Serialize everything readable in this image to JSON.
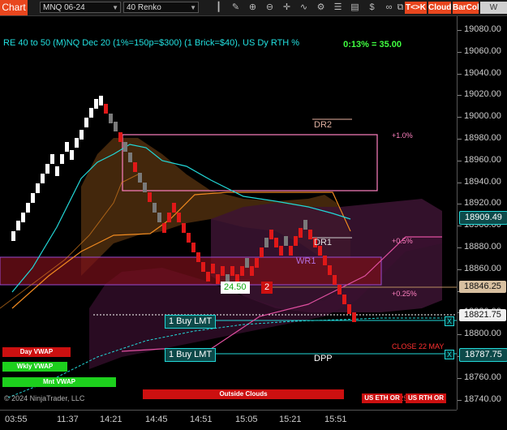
{
  "toolbar": {
    "chart_label": "Chart",
    "instrument": "MNQ 06-24",
    "bar_type": "40 Renko",
    "btn_tk": "T<>K",
    "btn_cloud": "Cloud",
    "btn_barcol": "BarCol",
    "btn_vwap": "W VWAP",
    "colors": {
      "chart": "#e8461e",
      "tk": "#e8461e",
      "cloud": "#e8461e",
      "barcol": "#e8461e",
      "vwap": "#cfcfcf"
    }
  },
  "header": {
    "title": "RE 40 to 50 (M)NQ Dec 20 (1%=150p=$300) (1 Brick=$40), US Dy RTH %",
    "status": "0:13% = 35.00"
  },
  "price_axis": {
    "ticks": [
      "19080.00",
      "19060.00",
      "19040.00",
      "19020.00",
      "19000.00",
      "18980.00",
      "18960.00",
      "18940.00",
      "18920.00",
      "18900.00",
      "18880.00",
      "18860.00",
      "18840.00",
      "18820.00",
      "18800.00",
      "18780.00",
      "18760.00",
      "18740.00"
    ],
    "current_price": "18909.49",
    "markers": [
      {
        "label": "18909.49",
        "style": "cyan"
      },
      {
        "label": "18846.25",
        "style": "tan"
      },
      {
        "label": "18821.75",
        "style": "white"
      },
      {
        "label": "18787.75",
        "style": "cyan"
      }
    ]
  },
  "time_axis": {
    "ticks": [
      "03:55",
      "11:37",
      "14:21",
      "14:45",
      "14:51",
      "15:05",
      "15:21",
      "15:51"
    ]
  },
  "levels": {
    "dr2": "DR2",
    "dr1": "DR1",
    "wr1": "WR1",
    "dpp": "DPP",
    "pct_1": "+1.0%",
    "pct_05": "+0.5%",
    "pct_025": "+0.25%",
    "close_label": "CLOSE 22 MAY",
    "pct_bottom": "0.25%"
  },
  "orders": {
    "buy_1": "1 Buy LMT",
    "buy_2": "1 Buy LMT",
    "close_x": "X",
    "position_value": "24.50",
    "position_qty": "2"
  },
  "tags": {
    "day_vwap": "Day VWAP",
    "wkly_vwap": "Wkly VWAP",
    "mnt_vwap": "Mnt VWAP",
    "outside_clouds": "Outside Clouds",
    "us_eth_or": "US ETH OR",
    "us_rth_or": "US RTH OR",
    "copyright": "© 2024 NinjaTrader, LLC"
  }
}
